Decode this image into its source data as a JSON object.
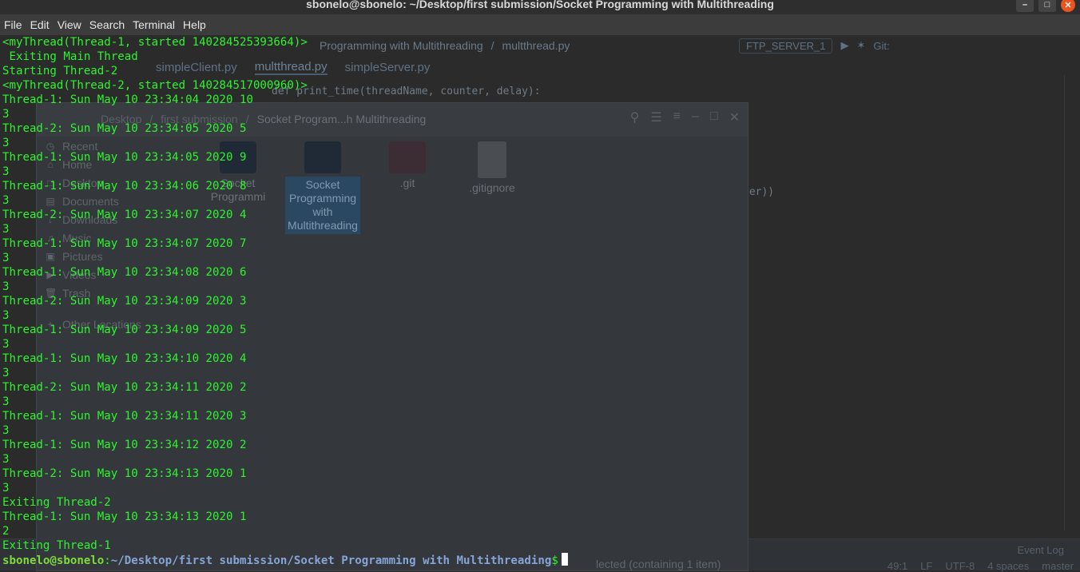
{
  "window": {
    "title": "sbonelo@sbonelo: ~/Desktop/first submission/Socket Programming with Multithreading"
  },
  "menubar": [
    "File",
    "Edit",
    "View",
    "Search",
    "Terminal",
    "Help"
  ],
  "ide": {
    "breadcrumb": [
      "Programming with Multithreading",
      "multthread.py"
    ],
    "run_config": "FTP_SERVER_1",
    "git_label": "Git:",
    "tabs": [
      "simpleClient.py",
      "multthread.py",
      "simpleServer.py"
    ],
    "code_line": "def print_time(threadName, counter, delay):",
    "code_fragment": "ter))",
    "event_log": "Event Log",
    "status": [
      "49:1",
      "LF",
      "UTF-8",
      "4 spaces",
      "master"
    ]
  },
  "file_manager": {
    "breadcrumb": [
      "Desktop",
      "first submission",
      "Socket Program...h Multithreading"
    ],
    "sidebar": [
      {
        "label": "Recent",
        "icon": "clock-icon"
      },
      {
        "label": "Home",
        "icon": "home-icon"
      },
      {
        "label": "Desktop",
        "icon": "desktop-icon"
      },
      {
        "label": "Documents",
        "icon": "document-icon"
      },
      {
        "label": "Downloads",
        "icon": "download-icon"
      },
      {
        "label": "Music",
        "icon": "music-icon"
      },
      {
        "label": "Pictures",
        "icon": "picture-icon"
      },
      {
        "label": "Videos",
        "icon": "video-icon"
      },
      {
        "label": "Trash",
        "icon": "trash-icon"
      },
      {
        "label": "Other Locations",
        "icon": "plus-icon"
      }
    ],
    "files": [
      {
        "label": "Socket Programmi",
        "type": "folder"
      },
      {
        "label": "Socket Programming with Multithreading",
        "type": "folder",
        "selected": true
      },
      {
        "label": ".git",
        "type": "folder-red"
      },
      {
        "label": ".gitignore",
        "type": "file"
      }
    ],
    "status": "lected  (containing 1 item)"
  },
  "terminal": {
    "lines": [
      "<myThread(Thread-1, started 140284525393664)>",
      " Exiting Main Thread",
      "Starting Thread-2",
      "<myThread(Thread-2, started 140284517000960)>",
      "Thread-1: Sun May 10 23:34:04 2020 10",
      "3",
      "Thread-2: Sun May 10 23:34:05 2020 5",
      "3",
      "Thread-1: Sun May 10 23:34:05 2020 9",
      "3",
      "Thread-1: Sun May 10 23:34:06 2020 8",
      "3",
      "Thread-2: Sun May 10 23:34:07 2020 4",
      "3",
      "Thread-1: Sun May 10 23:34:07 2020 7",
      "3",
      "Thread-1: Sun May 10 23:34:08 2020 6",
      "3",
      "Thread-2: Sun May 10 23:34:09 2020 3",
      "3",
      "Thread-1: Sun May 10 23:34:09 2020 5",
      "3",
      "Thread-1: Sun May 10 23:34:10 2020 4",
      "3",
      "Thread-2: Sun May 10 23:34:11 2020 2",
      "3",
      "Thread-1: Sun May 10 23:34:11 2020 3",
      "3",
      "Thread-1: Sun May 10 23:34:12 2020 2",
      "3",
      "Thread-2: Sun May 10 23:34:13 2020 1",
      "3",
      "Exiting Thread-2",
      "Thread-1: Sun May 10 23:34:13 2020 1",
      "2",
      "Exiting Thread-1"
    ],
    "prompt_user": "sbonelo@sbonelo",
    "prompt_sep": ":",
    "prompt_path": "~/Desktop/first submission/Socket Programming with Multithreading",
    "prompt_suffix": "$"
  }
}
